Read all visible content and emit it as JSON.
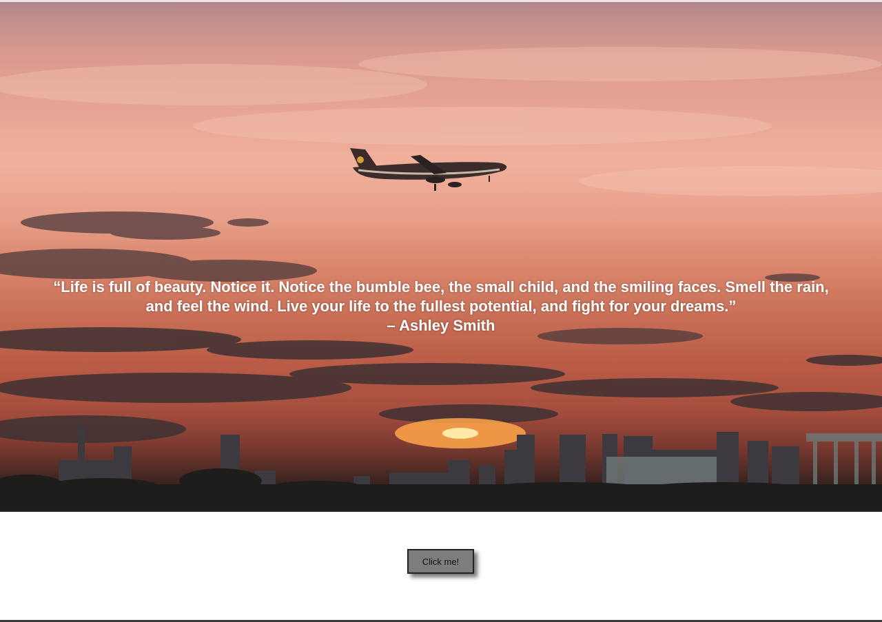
{
  "hero": {
    "image_description_icon": "sunset-city-airplane-image",
    "quote_line_1": "“Life is full of beauty. Notice it. Notice the bumble bee, the small child, and the smiling faces. Smell the rain,",
    "quote_line_2": "and feel the wind. Live your life to the fullest potential, and fight for your dreams.”",
    "author": "– Ashley Smith"
  },
  "main": {
    "button_label": "Click me!"
  },
  "colors": {
    "button_bg": "#7d7d7d",
    "quote_text": "#ffffff",
    "page_bg": "#ffffff"
  }
}
